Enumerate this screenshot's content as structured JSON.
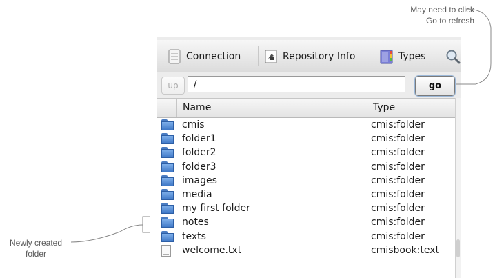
{
  "annotations": {
    "top_note": [
      "May need to click",
      "Go to refresh"
    ],
    "left_note": [
      "Newly created",
      "folder"
    ]
  },
  "toolbar": {
    "connection_label": "Connection",
    "repo_info_label": "Repository Info",
    "types_label": "Types"
  },
  "nav": {
    "up_label": "up",
    "path_value": "/",
    "go_label": "go"
  },
  "table": {
    "columns": [
      "Name",
      "Type"
    ],
    "rows": [
      {
        "name": "cmis",
        "type": "cmis:folder",
        "icon": "folder-icon"
      },
      {
        "name": "folder1",
        "type": "cmis:folder",
        "icon": "folder-icon"
      },
      {
        "name": "folder2",
        "type": "cmis:folder",
        "icon": "folder-icon"
      },
      {
        "name": "folder3",
        "type": "cmis:folder",
        "icon": "folder-icon"
      },
      {
        "name": "images",
        "type": "cmis:folder",
        "icon": "folder-icon"
      },
      {
        "name": "media",
        "type": "cmis:folder",
        "icon": "folder-icon"
      },
      {
        "name": "my first folder",
        "type": "cmis:folder",
        "icon": "folder-icon"
      },
      {
        "name": "notes",
        "type": "cmis:folder",
        "icon": "folder-icon"
      },
      {
        "name": "texts",
        "type": "cmis:folder",
        "icon": "folder-icon"
      },
      {
        "name": "welcome.txt",
        "type": "cmisbook:text",
        "icon": "document-icon"
      }
    ]
  }
}
